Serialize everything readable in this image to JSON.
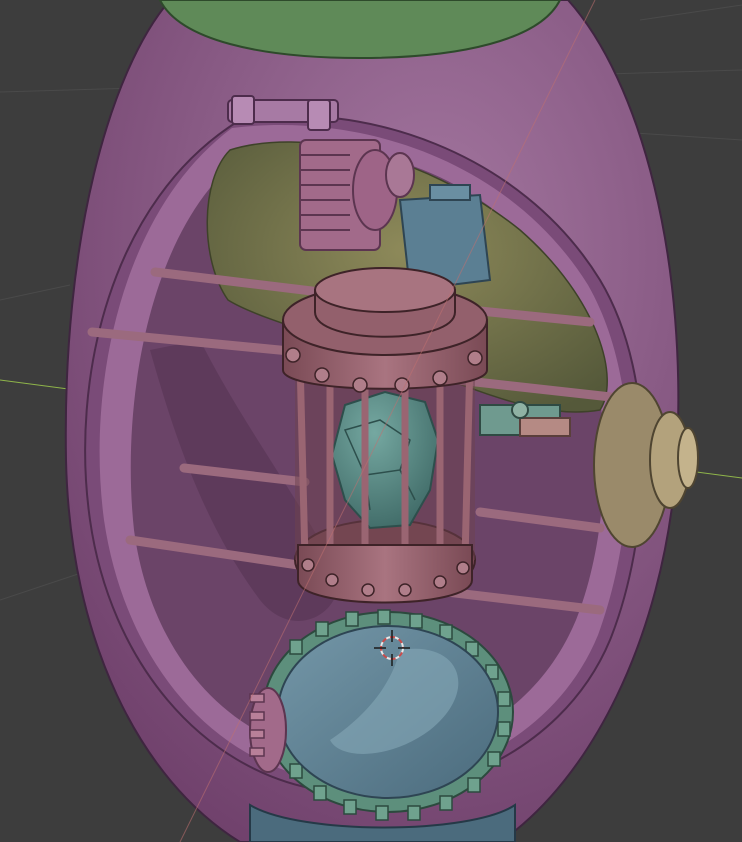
{
  "viewport": {
    "background": "#3d3d3d",
    "grid_color": "#4b4b4b",
    "axis_x_color": "#8fb54a",
    "axis_y_color": "#b3545c"
  },
  "model": {
    "shell_color": "#8a5585",
    "shell_inner_color": "#9a6896",
    "cap_color": "#5f8a58",
    "gear_color": "#a26a8a",
    "cage_color": "#8e5a65",
    "crystal_color": "#4d7f7b",
    "dial_color": "#5b7f93",
    "ring_gear_color": "#5d8f7c",
    "knob_color": "#9a8a6a",
    "interior_color": "#6d7a47"
  },
  "gizmo": {
    "name": "3d-cursor",
    "color": "#c98585"
  }
}
